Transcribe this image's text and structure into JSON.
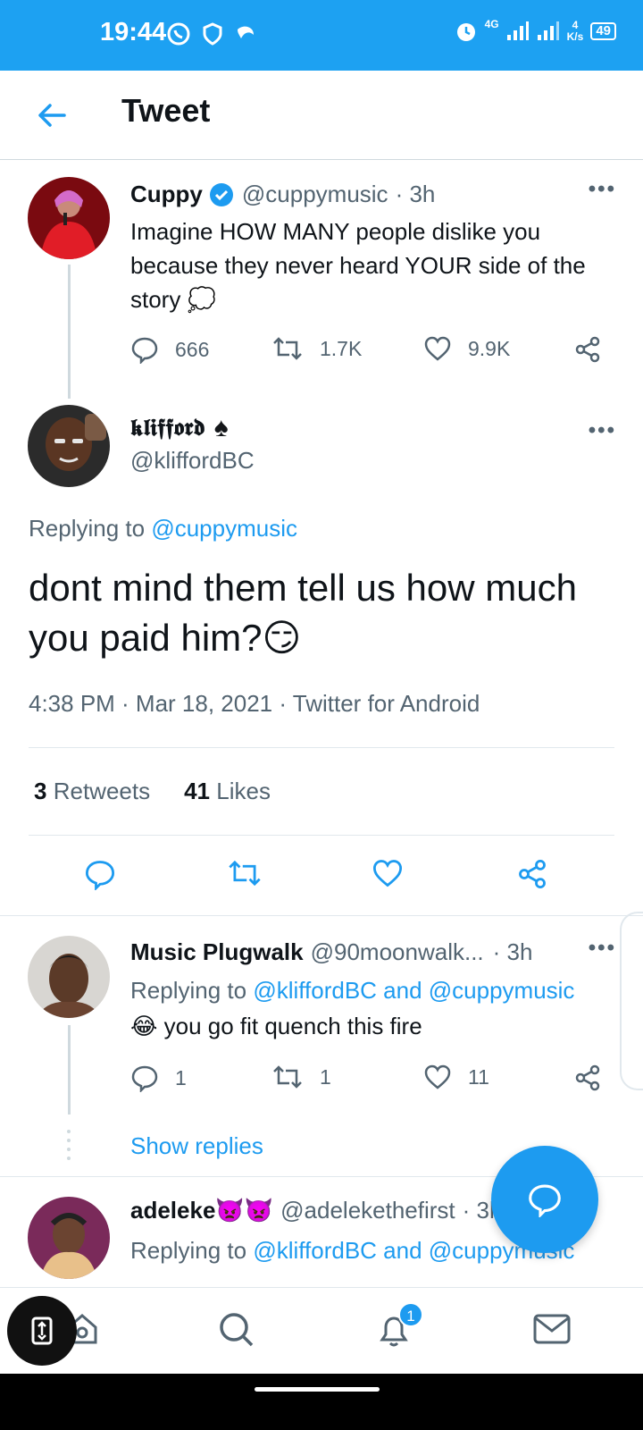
{
  "status_bar": {
    "time": "19:44",
    "network": "4G",
    "speed_value": "4",
    "speed_unit": "K/s",
    "battery": "49"
  },
  "header": {
    "title": "Tweet"
  },
  "parent_tweet": {
    "name": "Cuppy",
    "handle": "@cuppymusic",
    "time": "· 3h",
    "text": "Imagine HOW MANY people dislike you because they never heard YOUR side of the story",
    "emoji": "💭",
    "replies": "666",
    "retweets": "1.7K",
    "likes": "9.9K"
  },
  "focus_tweet": {
    "name": "𝖐𝖑𝖎𝖋𝖋𝖔𝖗𝖉",
    "name_suffix": "♠",
    "handle": "@kliffordBC",
    "reply_prefix": "Replying to ",
    "reply_to": "@cuppymusic",
    "text": "dont mind them tell us how much you paid him?",
    "emoji": "😏",
    "timestamp": "4:38 PM · Mar 18, 2021 · Twitter for Android",
    "retweet_count": "3",
    "retweet_label": "Retweets",
    "like_count": "41",
    "like_label": "Likes"
  },
  "replies": [
    {
      "name": "Music Plugwalk",
      "handle": "@90moonwalk...",
      "time": "· 3h",
      "reply_prefix": "Replying to ",
      "reply_to_1": "@kliffordBC",
      "reply_and": " and ",
      "reply_to_2": "@cuppymusic",
      "emoji": "😂",
      "text": " you go fit quench this fire",
      "replies": "1",
      "retweets": "1",
      "likes": "11",
      "show_replies": "Show replies"
    },
    {
      "name": "adeleke",
      "name_emoji": "👿👿",
      "handle": "@adelekethefirst",
      "time": "· 3h",
      "reply_prefix": "Replying to ",
      "reply_to_1": "@kliffordBC",
      "reply_and": " and ",
      "reply_to_2": "@cuppymusic"
    }
  ],
  "bottom_nav": {
    "notification_badge": "1",
    "items": [
      "home-icon",
      "search-icon",
      "bell-icon",
      "mail-icon"
    ]
  },
  "colors": {
    "status_bar": "#1da1f2",
    "accent": "#1d9bf0",
    "text": "#0f1419",
    "secondary": "#536471"
  }
}
